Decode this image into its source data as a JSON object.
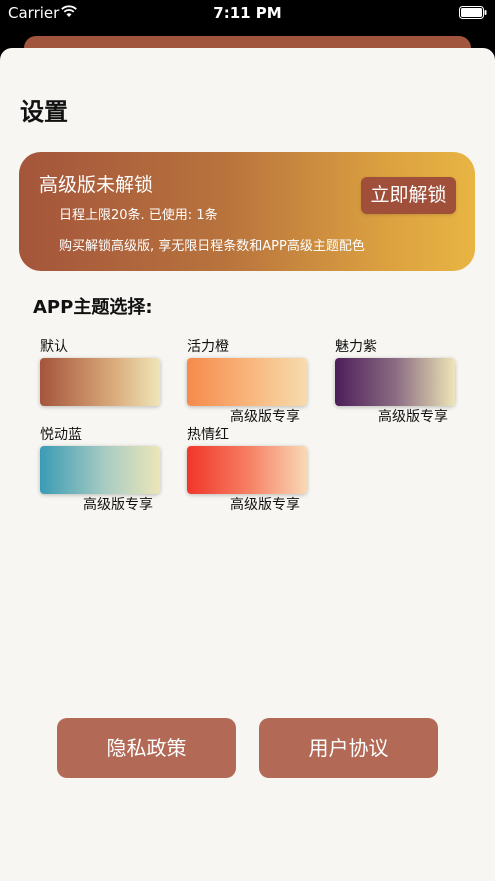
{
  "status_bar": {
    "carrier": "Carrier",
    "time": "7:11 PM",
    "wifi_icon": "wifi-icon",
    "battery_icon": "battery-icon"
  },
  "page": {
    "title": "设置"
  },
  "premium": {
    "title": "高级版未解锁",
    "limit_text": "日程上限20条. 已使用: 1条",
    "description": "购买解锁高级版, 享无限日程条数和APP高级主题配色",
    "unlock_label": "立即解锁",
    "gradient_colors": [
      "#a4553b",
      "#e8b543"
    ]
  },
  "themes": {
    "section_title": "APP主题选择:",
    "items": [
      {
        "name": "默认",
        "badge": "",
        "colors": [
          "#a4553b",
          "#efe5b8"
        ]
      },
      {
        "name": "活力橙",
        "badge": "高级版专享",
        "colors": [
          "#f58a4b",
          "#f6dcae"
        ]
      },
      {
        "name": "魅力紫",
        "badge": "高级版专享",
        "colors": [
          "#4d1e5a",
          "#eee5b7"
        ]
      },
      {
        "name": "悦动蓝",
        "badge": "高级版专享",
        "colors": [
          "#3b9bb4",
          "#ede6b8"
        ]
      },
      {
        "name": "热情红",
        "badge": "高级版专享",
        "colors": [
          "#f0362a",
          "#f9d9b5"
        ]
      }
    ]
  },
  "footer": {
    "privacy_label": "隐私政策",
    "agreement_label": "用户协议",
    "button_color": "#b26a57"
  }
}
